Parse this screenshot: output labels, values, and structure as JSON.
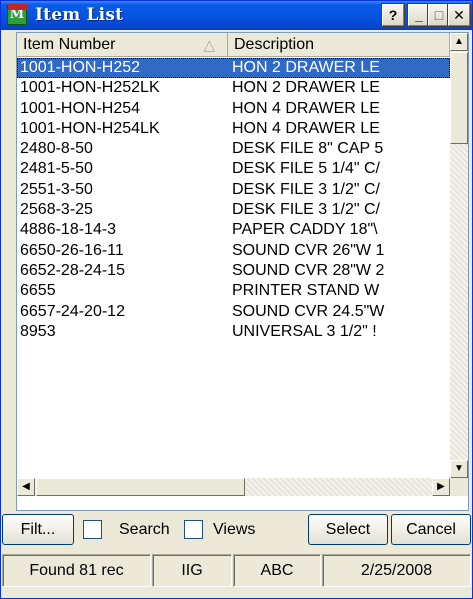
{
  "window": {
    "title": "Item List",
    "icon_letter": "M",
    "help_label": "?",
    "minimize_label": "_",
    "maximize_label": "□",
    "close_label": "✕"
  },
  "grid": {
    "columns": [
      {
        "label": "Item Number",
        "sort": "ascending"
      },
      {
        "label": "Description"
      }
    ],
    "selected_index": 0,
    "rows": [
      {
        "item": "1001-HON-H252",
        "desc": "HON 2 DRAWER LE"
      },
      {
        "item": "1001-HON-H252LK",
        "desc": "HON 2 DRAWER LE"
      },
      {
        "item": "1001-HON-H254",
        "desc": "HON 4 DRAWER LE"
      },
      {
        "item": "1001-HON-H254LK",
        "desc": "HON 4 DRAWER LE"
      },
      {
        "item": "2480-8-50",
        "desc": "DESK FILE 8\" CAP 5"
      },
      {
        "item": "2481-5-50",
        "desc": "DESK FILE 5 1/4\" C/"
      },
      {
        "item": "2551-3-50",
        "desc": "DESK FILE 3 1/2\" C/"
      },
      {
        "item": "2568-3-25",
        "desc": "DESK FILE 3 1/2\" C/"
      },
      {
        "item": "4886-18-14-3",
        "desc": "PAPER CADDY 18\"\\"
      },
      {
        "item": "6650-26-16-11",
        "desc": "SOUND CVR 26\"W 1"
      },
      {
        "item": "6652-28-24-15",
        "desc": "SOUND CVR 28\"W 2"
      },
      {
        "item": "6655",
        "desc": "PRINTER STAND W"
      },
      {
        "item": "6657-24-20-12",
        "desc": "SOUND CVR 24.5\"W"
      },
      {
        "item": "8953",
        "desc": "UNIVERSAL 3 1/2\" !"
      }
    ]
  },
  "toolbar": {
    "filter_label": "Filt...",
    "search_label": "Search",
    "views_label": "Views",
    "select_label": "Select",
    "cancel_label": "Cancel"
  },
  "status": {
    "found": "Found 81 rec",
    "company": "IIG",
    "code": "ABC",
    "date": "2/25/2008"
  },
  "colors": {
    "title_bar": "#0654e0",
    "selection": "#316ac5",
    "window_bg": "#ece9d8"
  },
  "icons": [
    "app-icon",
    "help-icon",
    "minimize-icon",
    "maximize-icon",
    "close-icon",
    "sort-ascending-icon",
    "scroll-up-icon",
    "scroll-down-icon",
    "scroll-left-icon",
    "scroll-right-icon"
  ]
}
